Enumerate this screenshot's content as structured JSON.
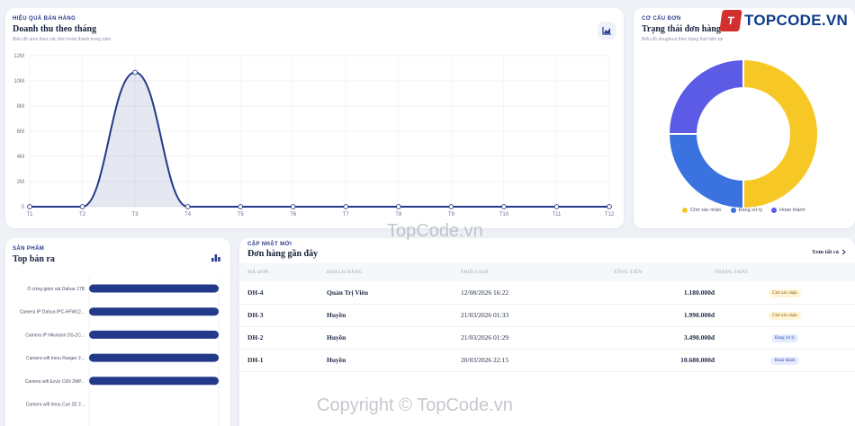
{
  "brand": {
    "logo_letter": "T",
    "name": "TOPCODE.VN"
  },
  "revenue": {
    "eyebrow": "HIỆU QUẢ BÁN HÀNG",
    "title": "Doanh thu theo tháng",
    "subtitle": "Biểu đồ area theo các đơn hoàn thành trong năm",
    "action_icon": "area-chart-icon"
  },
  "orders_status": {
    "eyebrow": "CƠ CẤU ĐƠN",
    "title": "Trạng thái đơn hàng",
    "subtitle": "Biểu đồ doughnut theo trạng thái hiện tại"
  },
  "top_products": {
    "eyebrow": "SẢN PHẨM",
    "title": "Top bán ra",
    "action_icon": "bar-chart-icon"
  },
  "recent_orders": {
    "eyebrow": "CẬP NHẬT MỚI",
    "title": "Đơn hàng gần đây",
    "view_all": "Xem tất cả",
    "columns": [
      "MÃ ĐƠN",
      "KHÁCH HÀNG",
      "THỜI GIAN",
      "TỔNG TIỀN",
      "TRẠNG THÁI"
    ],
    "rows": [
      {
        "id": "DH-4",
        "customer": "Quản Trị Viên",
        "time": "12/08/2026 16:22",
        "total": "1.180.000đ",
        "status": "Chờ xác nhận",
        "status_kind": "wait"
      },
      {
        "id": "DH-3",
        "customer": "Huyền",
        "time": "21/03/2026 01:33",
        "total": "1.990.000đ",
        "status": "Chờ xác nhận",
        "status_kind": "wait"
      },
      {
        "id": "DH-2",
        "customer": "Huyền",
        "time": "21/03/2026 01:29",
        "total": "3.490.000đ",
        "status": "Đang xử lý",
        "status_kind": "proc"
      },
      {
        "id": "DH-1",
        "customer": "Huyền",
        "time": "20/03/2026 22:15",
        "total": "10.680.000đ",
        "status": "Hoàn thành",
        "status_kind": "done"
      }
    ]
  },
  "watermarks": {
    "center": "TopCode.vn",
    "bottom": "Copyright © TopCode.vn"
  },
  "colors": {
    "primary": "#233a8b",
    "wait": "#f7c825",
    "processing": "#3a73e0",
    "done": "#5b5be6"
  },
  "chart_data": [
    {
      "type": "area",
      "categories": [
        "T1",
        "T2",
        "T3",
        "T4",
        "T5",
        "T6",
        "T7",
        "T8",
        "T9",
        "T10",
        "T11",
        "T12"
      ],
      "values": [
        0,
        0,
        10680000,
        0,
        0,
        0,
        0,
        0,
        0,
        0,
        0,
        0
      ],
      "ylim": [
        0,
        12000000
      ],
      "yticks": [
        0,
        2000000,
        4000000,
        6000000,
        8000000,
        10000000,
        12000000
      ],
      "ytick_labels": [
        "0",
        "2M",
        "4M",
        "6M",
        "8M",
        "10M",
        "12M"
      ],
      "grid": true,
      "color": "#233a8b"
    },
    {
      "type": "pie",
      "donut": true,
      "labels": [
        "Chờ xác nhận",
        "Đang xử lý",
        "Hoàn thành"
      ],
      "values": [
        2,
        1,
        1
      ],
      "colors": [
        "#f7c825",
        "#3a73e0",
        "#5b5be6"
      ],
      "legend": "bottom"
    },
    {
      "type": "bar",
      "orientation": "horizontal",
      "categories": [
        "Ổ cứng giám sát Dahua 1TB",
        "Camera IP Dahua IPC-HFW12...",
        "Camera IP Hikvision DS-2C...",
        "Camera wifi Imou Ranger 2...",
        "Camera wifi Ezviz C6N 2MP...",
        "Camera wifi Imou Cue 2E 2..."
      ],
      "values": [
        1,
        1,
        1,
        1,
        1,
        0
      ],
      "xlim": [
        0,
        1
      ],
      "color": "#233a8b"
    }
  ]
}
